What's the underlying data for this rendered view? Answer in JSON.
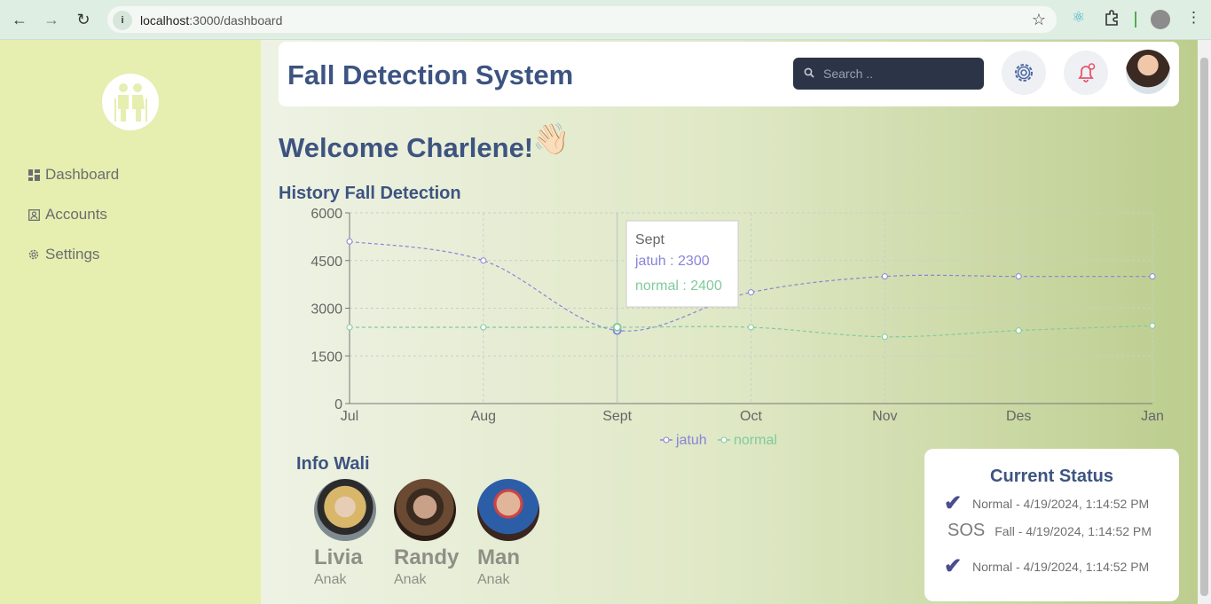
{
  "browser": {
    "url_host": "localhost",
    "url_path": ":3000/dashboard"
  },
  "sidebar": {
    "items": [
      {
        "label": "Dashboard",
        "icon": "dashboard-icon"
      },
      {
        "label": "Accounts",
        "icon": "account-icon"
      },
      {
        "label": "Settings",
        "icon": "gear-icon"
      }
    ]
  },
  "header": {
    "title": "Fall Detection System",
    "search_placeholder": "Search .."
  },
  "welcome": "Welcome Charlene!",
  "welcome_emoji": "👋🏻",
  "history_title": "History Fall Detection",
  "chart_data": {
    "type": "line",
    "categories": [
      "Jul",
      "Aug",
      "Sept",
      "Oct",
      "Nov",
      "Des",
      "Jan"
    ],
    "series": [
      {
        "name": "jatuh",
        "color": "#8884d8",
        "values": [
          5100,
          4500,
          2300,
          3500,
          4000,
          4000,
          4000
        ]
      },
      {
        "name": "normal",
        "color": "#82ca9d",
        "values": [
          2400,
          2400,
          2400,
          2400,
          2100,
          2300,
          2450
        ]
      }
    ],
    "yticks": [
      0,
      1500,
      3000,
      4500,
      6000
    ],
    "ylim": [
      0,
      6000
    ],
    "grid": true,
    "legend": "bottom",
    "tooltip": {
      "category": "Sept",
      "jatuh_text": "jatuh : 2300",
      "normal_text": "normal : 2400"
    }
  },
  "wali": {
    "title": "Info Wali",
    "people": [
      {
        "name": "Livia",
        "role": "Anak"
      },
      {
        "name": "Randy",
        "role": "Anak"
      },
      {
        "name": "Man",
        "role": "Anak"
      }
    ]
  },
  "status": {
    "title": "Current Status",
    "rows": [
      {
        "mark": "✔",
        "text": "Normal - 4/19/2024, 1:14:52 PM"
      },
      {
        "mark": "SOS",
        "text": "Fall - 4/19/2024, 1:14:52 PM"
      },
      {
        "mark": "✔",
        "text": "Normal - 4/19/2024, 1:14:52 PM"
      }
    ]
  }
}
